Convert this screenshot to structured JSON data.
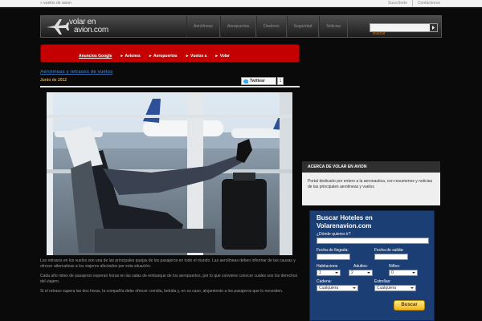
{
  "topbar": {
    "breadcrumb": "» vuelos de avion",
    "links": [
      "Suscríbete",
      "Contáctenos"
    ]
  },
  "header": {
    "logo_line1": "volar en",
    "logo_line2": "avion.com",
    "nav": [
      "Aerolíneas",
      "Aeropuertos",
      "Destinos",
      "Seguridad",
      "Noticias"
    ],
    "search_value": "Buscar"
  },
  "adbar": {
    "title": "Anuncios Google",
    "links": [
      "► Aviones",
      "► Aeropuertos",
      "► Vuelos a",
      "► Volar"
    ]
  },
  "post": {
    "title": "Aerolíneas y retrasos de vuelos",
    "date": "Junio de 2012",
    "tweet_label": "Twittear",
    "tweet_count": "1",
    "paragraphs": [
      "Los retrasos en los vuelos son una de las principales quejas de los pasajeros en todo el mundo. Las aerolíneas deben informar de las causas y ofrecer alternativas a los viajeros afectados por esta situación.",
      "Cada año miles de pasajeros esperan horas en las salas de embarque de los aeropuertos, por lo que conviene conocer cuáles son los derechos del viajero.",
      "Si el retraso supera las dos horas, la compañía debe ofrecer comida, bebida y, en su caso, alojamiento a los pasajeros que lo necesiten."
    ]
  },
  "about": {
    "title": "ACERCA DE VOLAR EN AVION",
    "text": "Portal dedicado por entero a la aeronautica, con resumenes y noticias de las principales aerolineas y vuelos"
  },
  "hotels": {
    "title": "Buscar Hoteles en Volarenavion.com",
    "where_label": "¿Dónde quieres ir?",
    "arrival_label": "Fecha de llegada:",
    "departure_label": "Fecha de salida:",
    "room_label": "Habitacione",
    "adults_label": "Adultos:",
    "kids_label": "Niños:",
    "room_value": "1",
    "adults_value": "2",
    "kids_value": "0",
    "chain_label": "Cadena:",
    "stars_label": "Estrellas:",
    "chain_value": "Cualquiera",
    "stars_value": "Cualquiera",
    "button": "Buscar"
  }
}
